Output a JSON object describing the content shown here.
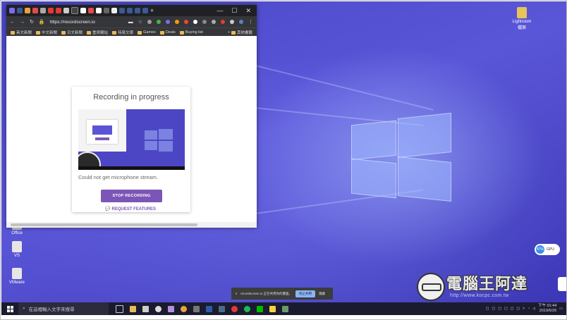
{
  "browser": {
    "url": "https://recordscreen.io",
    "bookmarks": [
      "英文新聞",
      "中文新聞",
      "日文新聞",
      "重資網站",
      "待寫文章",
      "Games",
      "Deals",
      "Buying list",
      "其他書籤"
    ],
    "window_controls": [
      "—",
      "☐",
      "✕"
    ]
  },
  "recorder": {
    "title": "Recording in progress",
    "mic_warning": "Could not get microphone stream.",
    "stop_label": "STOP RECORDING",
    "request_label": "REQUEST FEATURES"
  },
  "desktop": {
    "icons": [
      {
        "label": "Lightroom\n檔案"
      },
      {
        "label": "Office"
      },
      {
        "label": "VS"
      },
      {
        "label": "VMware"
      }
    ]
  },
  "sharebar": {
    "message": "recordscreen.io 正在共用你的畫面。",
    "stop_label": "停止共用",
    "hide_label": "隱藏"
  },
  "gpu_widget": {
    "percent": "47%",
    "label": "GPU"
  },
  "watermark": {
    "title": "電腦王阿達",
    "url": "http://www.kocpc.com.tw"
  },
  "taskbar": {
    "search_placeholder": "在這裡輸入文字來搜尋",
    "time": "下午 01:44",
    "date": "2019/6/26"
  },
  "colors": {
    "accent": "#7b56b6",
    "desktop": "#4b47c9",
    "taskbar": "#1b1b2f"
  }
}
